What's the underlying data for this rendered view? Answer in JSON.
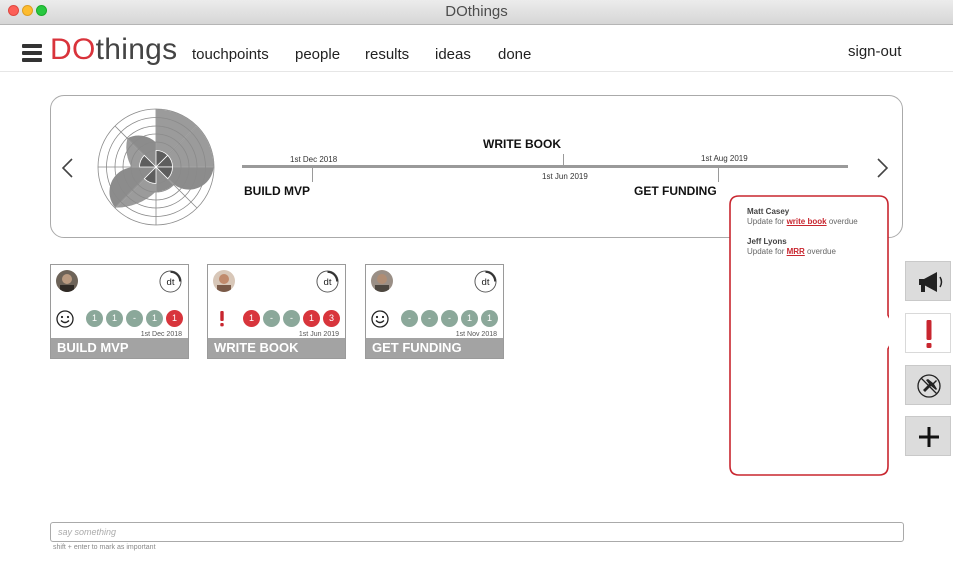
{
  "window": {
    "title": "DOthings"
  },
  "header": {
    "brand_do": "DO",
    "brand_rest": "things",
    "nav": [
      {
        "label": "touchpoints"
      },
      {
        "label": "people"
      },
      {
        "label": "results"
      },
      {
        "label": "ideas"
      },
      {
        "label": "done"
      }
    ],
    "signout_label": "sign-out"
  },
  "timeline": {
    "items": [
      {
        "label": "BUILD MVP",
        "date": "1st Dec 2018"
      },
      {
        "label": "WRITE BOOK",
        "date": "1st Jun 2019"
      },
      {
        "label": "GET FUNDING",
        "date": "1st Aug 2019"
      }
    ]
  },
  "cards": [
    {
      "title": "BUILD MVP",
      "date": "1st Dec 2018",
      "status_icon": "smiley-icon",
      "dots": [
        {
          "v": "1",
          "c": "g"
        },
        {
          "v": "1",
          "c": "g"
        },
        {
          "v": "-",
          "c": "g"
        },
        {
          "v": "1",
          "c": "g"
        },
        {
          "v": "1",
          "c": "r"
        }
      ]
    },
    {
      "title": "WRITE BOOK",
      "date": "1st Jun 2019",
      "status_icon": "exclamation-icon",
      "dots": [
        {
          "v": "1",
          "c": "r"
        },
        {
          "v": "-",
          "c": "g"
        },
        {
          "v": "-",
          "c": "g"
        },
        {
          "v": "1",
          "c": "r"
        },
        {
          "v": "3",
          "c": "r"
        }
      ]
    },
    {
      "title": "GET FUNDING",
      "date": "1st Nov 2018",
      "status_icon": "smiley-icon",
      "dots": [
        {
          "v": "-",
          "c": "g"
        },
        {
          "v": "-",
          "c": "g"
        },
        {
          "v": "-",
          "c": "g"
        },
        {
          "v": "1",
          "c": "g"
        },
        {
          "v": "1",
          "c": "g"
        }
      ]
    }
  ],
  "notifications": [
    {
      "name": "Matt Casey",
      "pre": "Update for ",
      "link": "write book",
      "post": " overdue"
    },
    {
      "name": "Jeff Lyons",
      "pre": "Update for ",
      "link": "MRR",
      "post": " overdue"
    }
  ],
  "side_buttons": [
    {
      "icon": "megaphone-icon"
    },
    {
      "icon": "exclamation-icon",
      "active": true
    },
    {
      "icon": "no-flight-icon"
    },
    {
      "icon": "plus-icon"
    }
  ],
  "composer": {
    "placeholder": "say something",
    "hint": "shift + enter to mark as important"
  },
  "colors": {
    "accent": "#d9333b",
    "dot_green": "#8ba89a",
    "dot_red": "#d8353c",
    "card_footer": "#a3a3a3"
  }
}
